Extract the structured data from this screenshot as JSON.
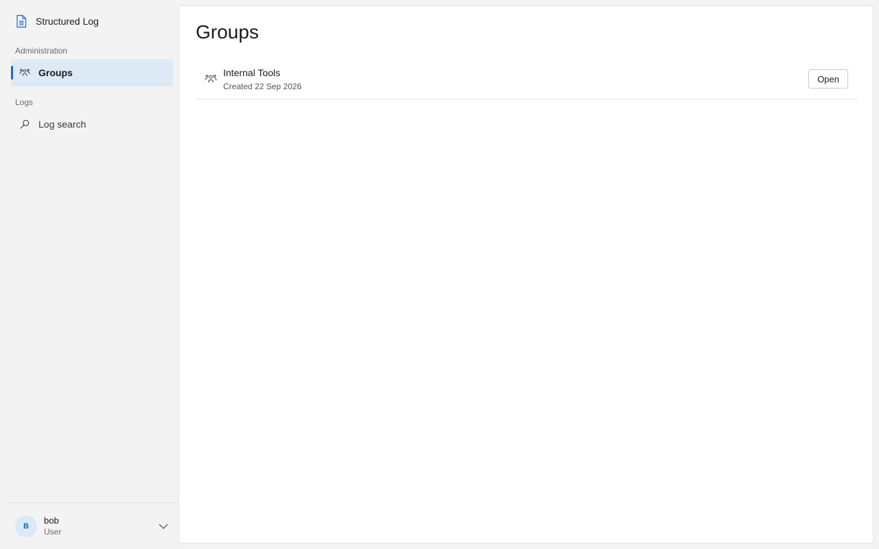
{
  "app": {
    "title": "Structured Log",
    "icon": "document-icon"
  },
  "sidebar": {
    "sections": [
      {
        "label": "Administration",
        "items": [
          {
            "label": "Groups",
            "icon": "people-icon",
            "active": true
          }
        ]
      },
      {
        "label": "Logs",
        "items": [
          {
            "label": "Log search",
            "icon": "search-icon",
            "active": false
          }
        ]
      }
    ]
  },
  "user": {
    "initial": "B",
    "name": "bob",
    "role": "User"
  },
  "main": {
    "title": "Groups",
    "groups": [
      {
        "name": "Internal Tools",
        "meta": "Created 22 Sep 2026",
        "action_label": "Open",
        "icon": "people-icon"
      }
    ]
  },
  "colors": {
    "accent": "#1668c9",
    "active_background": "#dde9f5",
    "sidebar_background": "#f3f3f3",
    "content_background": "#ffffff"
  }
}
